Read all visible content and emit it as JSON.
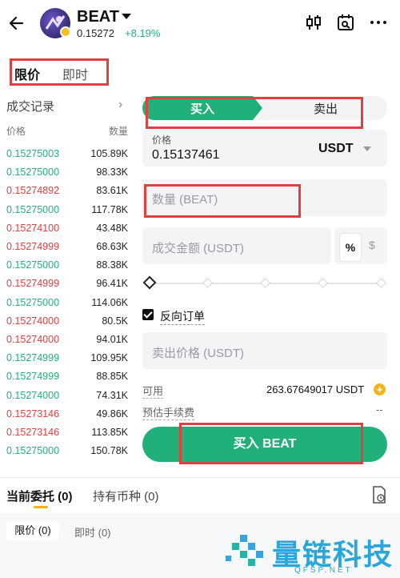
{
  "header": {
    "pair": "BEAT",
    "price": "0.15272",
    "change": "+8.19%"
  },
  "order_type_tabs": [
    {
      "label": "限价",
      "active": true
    },
    {
      "label": "即时",
      "active": false
    }
  ],
  "order_book": {
    "title": "成交记录",
    "col_price": "价格",
    "col_qty": "数量",
    "rows": [
      {
        "price": "0.15275003",
        "qty": "105.89K",
        "side": "buy"
      },
      {
        "price": "0.15275000",
        "qty": "98.33K",
        "side": "buy"
      },
      {
        "price": "0.15274892",
        "qty": "83.61K",
        "side": "sell"
      },
      {
        "price": "0.15275000",
        "qty": "117.78K",
        "side": "buy"
      },
      {
        "price": "0.15274100",
        "qty": "43.48K",
        "side": "sell"
      },
      {
        "price": "0.15274999",
        "qty": "68.63K",
        "side": "sell"
      },
      {
        "price": "0.15275000",
        "qty": "88.38K",
        "side": "buy"
      },
      {
        "price": "0.15274999",
        "qty": "96.41K",
        "side": "sell"
      },
      {
        "price": "0.15275000",
        "qty": "114.06K",
        "side": "buy"
      },
      {
        "price": "0.15274000",
        "qty": "80.5K",
        "side": "sell"
      },
      {
        "price": "0.15274000",
        "qty": "94.01K",
        "side": "sell"
      },
      {
        "price": "0.15274999",
        "qty": "109.95K",
        "side": "buy"
      },
      {
        "price": "0.15274999",
        "qty": "88.85K",
        "side": "buy"
      },
      {
        "price": "0.15274000",
        "qty": "74.31K",
        "side": "buy"
      },
      {
        "price": "0.15273146",
        "qty": "49.86K",
        "side": "sell"
      },
      {
        "price": "0.15273146",
        "qty": "113.85K",
        "side": "sell"
      },
      {
        "price": "0.15275000",
        "qty": "150.78K",
        "side": "buy"
      }
    ]
  },
  "trade_form": {
    "buy_label": "买入",
    "sell_label": "卖出",
    "price_label": "价格",
    "price_value": "0.15137461",
    "quote_currency": "USDT",
    "qty_placeholder": "数量 (BEAT)",
    "amount_placeholder": "成交金额 (USDT)",
    "pct_label": "%",
    "dollar_label": "$",
    "reverse_order_label": "反向订单",
    "reverse_order_checked": true,
    "sell_price_placeholder": "卖出价格 (USDT)",
    "available_label": "可用",
    "available_value": "263.67649017 USDT",
    "fee_label": "预估手续费",
    "fee_value": "--",
    "submit_label": "买入 BEAT"
  },
  "bottom_tabs": [
    {
      "label": "当前委托 (0)",
      "active": true
    },
    {
      "label": "持有币种 (0)",
      "active": false
    }
  ],
  "filter_chips": [
    {
      "label": "限价 (0)",
      "active": true
    },
    {
      "label": "即时 (0)",
      "active": false
    }
  ],
  "watermark": {
    "text": "量链科技",
    "sub": "QFSP.NET"
  },
  "colors": {
    "green": "#23b07d",
    "red": "#e0403f",
    "highlight_box": "#e0403f",
    "accent_yellow": "#f2b419"
  }
}
